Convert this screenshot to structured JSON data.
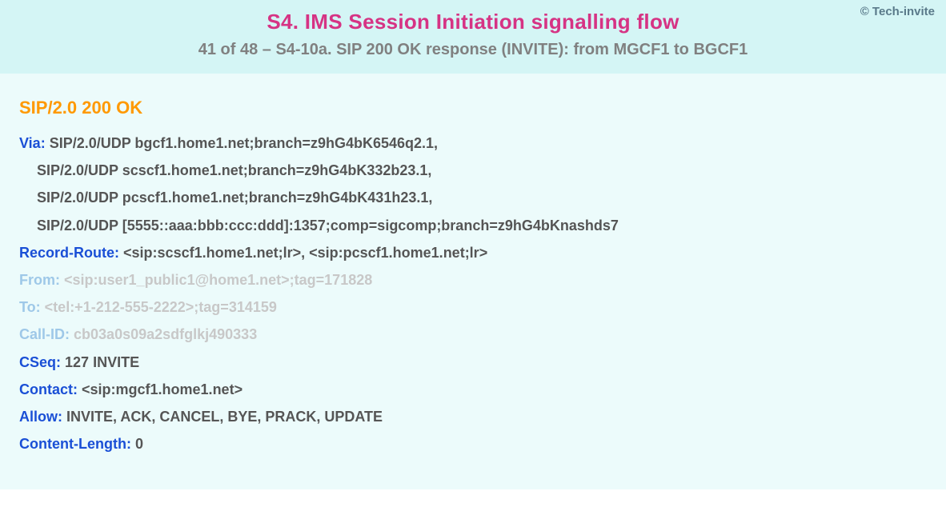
{
  "copyright": "© Tech-invite",
  "header": {
    "title": "S4. IMS Session Initiation signalling flow",
    "subtitle": "41 of 48 – S4-10a. SIP 200 OK response (INVITE): from MGCF1 to BGCF1"
  },
  "sip": {
    "status_line": "SIP/2.0 200 OK",
    "via": {
      "name": "Via",
      "values": [
        "SIP/2.0/UDP bgcf1.home1.net;branch=z9hG4bK6546q2.1,",
        "SIP/2.0/UDP scscf1.home1.net;branch=z9hG4bK332b23.1,",
        "SIP/2.0/UDP pcscf1.home1.net;branch=z9hG4bK431h23.1,",
        "SIP/2.0/UDP [5555::aaa:bbb:ccc:ddd]:1357;comp=sigcomp;branch=z9hG4bKnashds7"
      ]
    },
    "record_route": {
      "name": "Record-Route",
      "value": "<sip:scscf1.home1.net;lr>, <sip:pcscf1.home1.net;lr>"
    },
    "from": {
      "name": "From",
      "value": "<sip:user1_public1@home1.net>;tag=171828"
    },
    "to": {
      "name": "To",
      "value": "<tel:+1-212-555-2222>;tag=314159"
    },
    "call_id": {
      "name": "Call-ID",
      "value": "cb03a0s09a2sdfglkj490333"
    },
    "cseq": {
      "name": "CSeq",
      "value": "127 INVITE"
    },
    "contact": {
      "name": "Contact",
      "value": "<sip:mgcf1.home1.net>"
    },
    "allow": {
      "name": "Allow",
      "value": "INVITE, ACK, CANCEL, BYE, PRACK, UPDATE"
    },
    "content_length": {
      "name": "Content-Length",
      "value": "0"
    }
  }
}
